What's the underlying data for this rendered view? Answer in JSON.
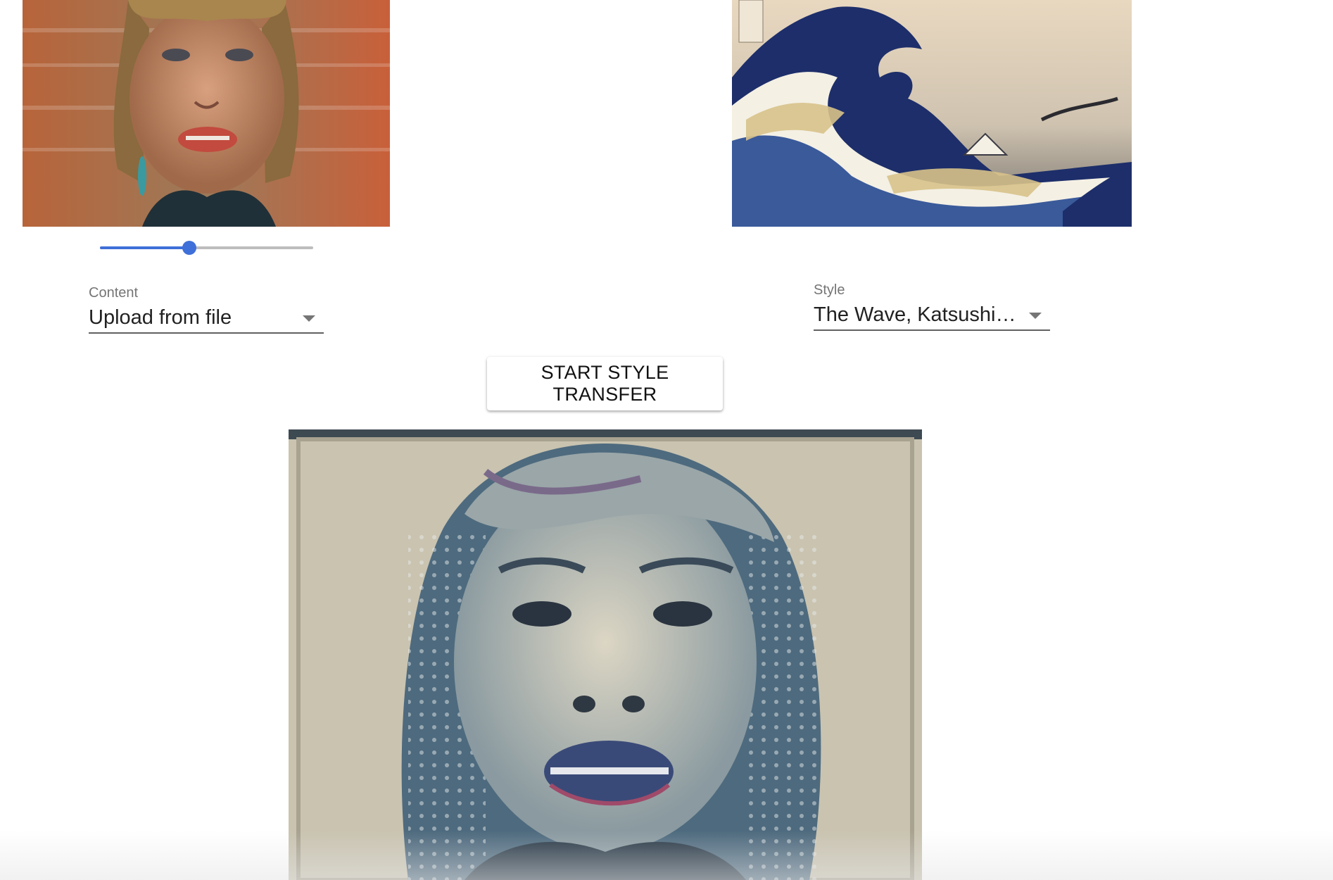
{
  "content_image": {
    "alt": "content image"
  },
  "style_image": {
    "alt": "style image"
  },
  "result_image": {
    "alt": "stylized result image"
  },
  "slider": {
    "value": 0.42
  },
  "content_select": {
    "label": "Content",
    "value": "Upload from file"
  },
  "style_select": {
    "label": "Style",
    "value": "The Wave, Katsushik…"
  },
  "start_button": {
    "label": "START STYLE TRANSFER"
  },
  "colors": {
    "accent": "#3f6fd8",
    "track": "#bdbdbd",
    "text": "#212121",
    "label": "#757575"
  }
}
